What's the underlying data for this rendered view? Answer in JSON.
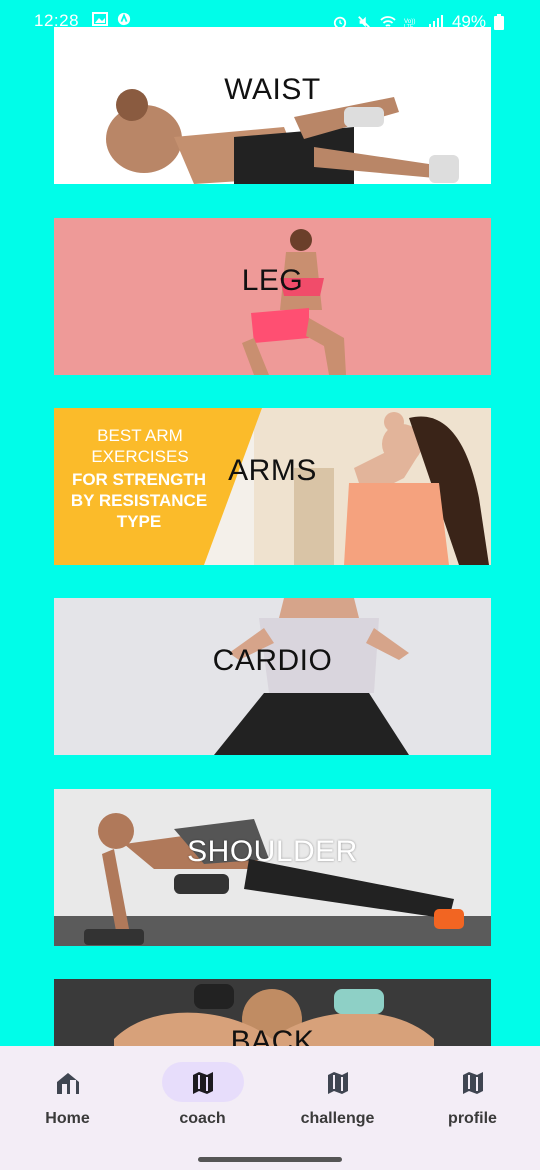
{
  "status_bar": {
    "time": "12:28",
    "battery": "49%",
    "icons": [
      "gallery-icon",
      "app-notification-icon",
      "alarm-icon",
      "mute-icon",
      "wifi-icon",
      "volte-icon",
      "signal-icon",
      "battery-icon"
    ]
  },
  "categories": [
    {
      "label": "WAIST",
      "color_theme": "#ffffff"
    },
    {
      "label": "LEG",
      "color_theme": "#ee9a98"
    },
    {
      "label": "ARMS",
      "color_theme": "#f4f0ea",
      "promo": {
        "line1": "BEST ARM EXERCISES",
        "line2": "FOR STRENGTH BY RESISTANCE TYPE",
        "color": "#fbbb2a"
      }
    },
    {
      "label": "CARDIO",
      "color_theme": "#e4e4e8"
    },
    {
      "label": "SHOULDER",
      "color_theme": "#e9e9e9"
    },
    {
      "label": "BACK",
      "color_theme": "#3a3a3a"
    }
  ],
  "bottom_nav": {
    "items": [
      {
        "label": "Home",
        "icon": "home-icon",
        "active": false
      },
      {
        "label": "coach",
        "icon": "map-icon",
        "active": true
      },
      {
        "label": "challenge",
        "icon": "map-icon",
        "active": false
      },
      {
        "label": "profile",
        "icon": "map-icon",
        "active": false
      }
    ],
    "active_pill_color": "#e7ddfb"
  }
}
